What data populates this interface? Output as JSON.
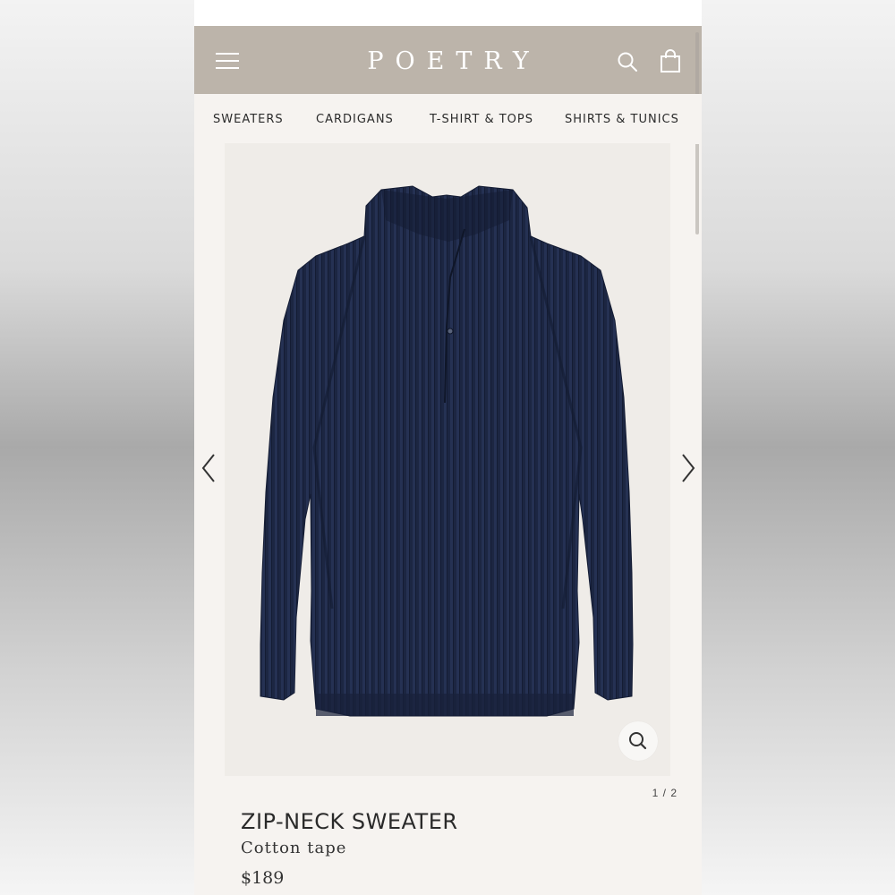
{
  "brand": "POETRY",
  "nav": {
    "categories": [
      "SWEATERS",
      "CARDIGANS",
      "T-SHIRT & TOPS",
      "SHIRTS & TUNICS"
    ]
  },
  "product": {
    "name": "ZIP-NECK SWEATER",
    "material": "Cotton tape",
    "price": "$189",
    "image_pager": "1 / 2",
    "image_subject": "navy ribbed zip-neck sweater"
  },
  "icons": {
    "menu": "hamburger-icon",
    "search": "search-icon",
    "bag": "shopping-bag-icon",
    "prev": "chevron-left-icon",
    "next": "chevron-right-icon",
    "zoom": "zoom-icon"
  },
  "colors": {
    "header_bg": "#bcb4aa",
    "page_bg": "#f6f3f0",
    "image_bg": "#efece8",
    "sweater": "#1b2540"
  }
}
